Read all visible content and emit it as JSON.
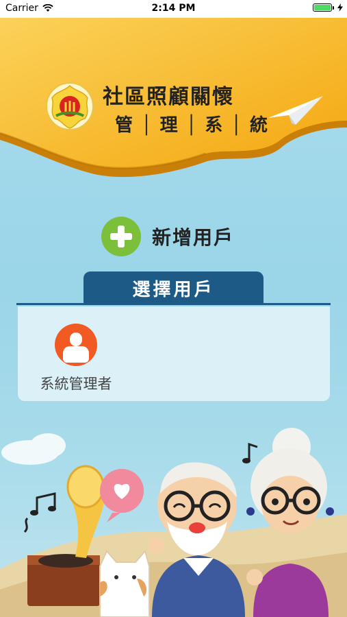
{
  "status_bar": {
    "carrier": "Carrier",
    "time": "2:14 PM",
    "battery_level": 1.0
  },
  "header": {
    "title_line1": "社區照顧關懷",
    "title_line2": "管│理│系│統",
    "banner_color": "#f7b81b",
    "logo_icon": "emblem-icon",
    "decoration_icon": "paper-plane-icon"
  },
  "actions": {
    "add_user_label": "新增用戶",
    "add_icon": "plus-circle-icon",
    "accent_green": "#7cbf3b"
  },
  "user_select": {
    "tab_label": "選擇用戶",
    "tab_color": "#1d5a85",
    "users": [
      {
        "name": "系統管理者",
        "avatar_color": "#f15a22"
      }
    ]
  }
}
